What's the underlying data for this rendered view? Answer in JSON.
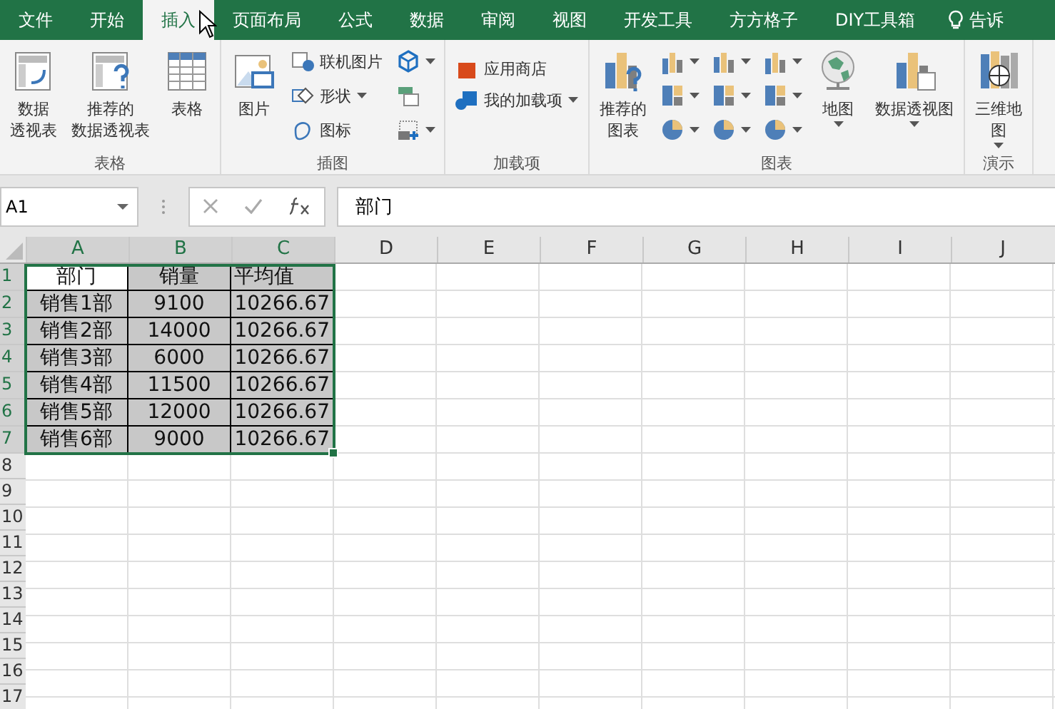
{
  "tabs": [
    {
      "label": "文件",
      "selected": false
    },
    {
      "label": "开始",
      "selected": false
    },
    {
      "label": "插入",
      "selected": true
    },
    {
      "label": "页面布局",
      "selected": false
    },
    {
      "label": "公式",
      "selected": false
    },
    {
      "label": "数据",
      "selected": false
    },
    {
      "label": "审阅",
      "selected": false
    },
    {
      "label": "视图",
      "selected": false
    },
    {
      "label": "开发工具",
      "selected": false
    },
    {
      "label": "方方格子",
      "selected": false
    },
    {
      "label": "DIY工具箱",
      "selected": false
    }
  ],
  "tell_me": "告诉",
  "ribbon": [
    {
      "label": "表格",
      "items": [
        {
          "kind": "large",
          "lines": [
            "数据",
            "透视表"
          ],
          "dropdown": false
        },
        {
          "kind": "large",
          "lines": [
            "推荐的",
            "数据透视表"
          ],
          "dropdown": false
        },
        {
          "kind": "large",
          "lines": [
            "表格"
          ],
          "dropdown": false
        }
      ]
    },
    {
      "label": "插图",
      "items": [
        {
          "kind": "large",
          "lines": [
            "图片"
          ],
          "dropdown": false
        },
        {
          "kind": "small",
          "lines": [
            "联机图片"
          ],
          "dropdown": false
        },
        {
          "kind": "small",
          "lines": [
            "形状"
          ],
          "dropdown": true
        },
        {
          "kind": "small",
          "lines": [
            "图标"
          ],
          "dropdown": false
        },
        {
          "kind": "icon",
          "dropdown": true
        },
        {
          "kind": "icon",
          "dropdown": false
        },
        {
          "kind": "icon",
          "dropdown": true
        }
      ]
    },
    {
      "label": "加载项",
      "items": [
        {
          "kind": "small",
          "lines": [
            "应用商店"
          ],
          "dropdown": false
        },
        {
          "kind": "small",
          "lines": [
            "我的加载项"
          ],
          "dropdown": true
        }
      ]
    },
    {
      "label": "图表",
      "items": [
        {
          "kind": "large",
          "lines": [
            "推荐的",
            "图表"
          ],
          "dropdown": false
        },
        {
          "kind": "icon",
          "dropdown": true
        },
        {
          "kind": "icon",
          "dropdown": true
        },
        {
          "kind": "icon",
          "dropdown": true
        },
        {
          "kind": "icon",
          "dropdown": true
        },
        {
          "kind": "icon",
          "dropdown": true
        },
        {
          "kind": "icon",
          "dropdown": true
        },
        {
          "kind": "icon",
          "dropdown": true
        },
        {
          "kind": "icon",
          "dropdown": true
        },
        {
          "kind": "icon",
          "dropdown": true
        },
        {
          "kind": "large",
          "lines": [
            "地图"
          ],
          "dropdown": true
        },
        {
          "kind": "large",
          "lines": [
            "数据透视图"
          ],
          "dropdown": true
        }
      ]
    },
    {
      "label": "演示",
      "items": [
        {
          "kind": "large",
          "lines": [
            "三维地",
            "图"
          ],
          "dropdown": true
        }
      ]
    }
  ],
  "name_box": "A1",
  "formula": "部门",
  "columns": [
    "A",
    "B",
    "C",
    "D",
    "E",
    "F",
    "G",
    "H",
    "I",
    "J"
  ],
  "row_numbers": [
    "1",
    "2",
    "3",
    "4",
    "5",
    "6",
    "7",
    "8",
    "9",
    "10",
    "11",
    "12",
    "13",
    "14",
    "15",
    "16",
    "17"
  ],
  "rows": [
    [
      {
        "text": "部门",
        "active": true
      },
      {
        "text": "销量",
        "active": false
      },
      {
        "text": "平均值",
        "active": false
      }
    ],
    [
      {
        "text": "销售1部",
        "active": false
      },
      {
        "text": "9100",
        "active": false
      },
      {
        "text": "10266.67",
        "active": false
      }
    ],
    [
      {
        "text": "销售2部",
        "active": false
      },
      {
        "text": "14000",
        "active": false
      },
      {
        "text": "10266.67",
        "active": false
      }
    ],
    [
      {
        "text": "销售3部",
        "active": false
      },
      {
        "text": "6000",
        "active": false
      },
      {
        "text": "10266.67",
        "active": false
      }
    ],
    [
      {
        "text": "销售4部",
        "active": false
      },
      {
        "text": "11500",
        "active": false
      },
      {
        "text": "10266.67",
        "active": false
      }
    ],
    [
      {
        "text": "销售5部",
        "active": false
      },
      {
        "text": "12000",
        "active": false
      },
      {
        "text": "10266.67",
        "active": false
      }
    ],
    [
      {
        "text": "销售6部",
        "active": false
      },
      {
        "text": "9000",
        "active": false
      },
      {
        "text": "10266.67",
        "active": false
      }
    ]
  ]
}
